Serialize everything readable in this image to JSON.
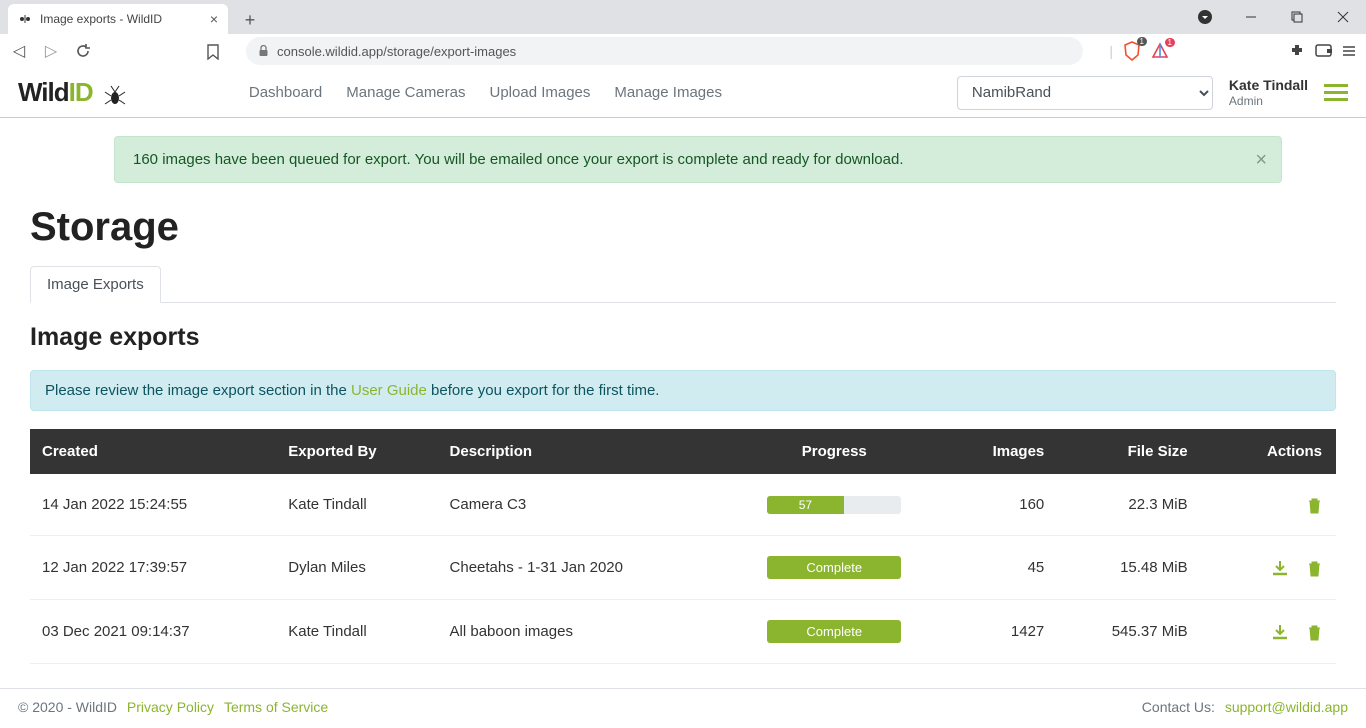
{
  "browser": {
    "tab_title": "Image exports - WildID",
    "url": "console.wildid.app/storage/export-images",
    "shield_badge": "1",
    "triangle_badge": "1"
  },
  "header": {
    "nav": [
      "Dashboard",
      "Manage Cameras",
      "Upload Images",
      "Manage Images"
    ],
    "project_selected": "NamibRand",
    "user_name": "Kate Tindall",
    "user_role": "Admin"
  },
  "alert_success": "160 images have been queued for export. You will be emailed once your export is complete and ready for download.",
  "page_title": "Storage",
  "active_tab": "Image Exports",
  "section_title": "Image exports",
  "info_prefix": "Please review the image export section in the ",
  "info_link": "User Guide",
  "info_suffix": " before you export for the first time.",
  "table": {
    "headers": {
      "created": "Created",
      "exported_by": "Exported By",
      "description": "Description",
      "progress": "Progress",
      "images": "Images",
      "file_size": "File Size",
      "actions": "Actions"
    },
    "rows": [
      {
        "created": "14 Jan 2022 15:24:55",
        "exported_by": "Kate Tindall",
        "description": "Camera C3",
        "progress_pct": 57,
        "progress_label": "57",
        "complete": false,
        "images": "160",
        "file_size": "22.3 MiB",
        "downloadable": false
      },
      {
        "created": "12 Jan 2022 17:39:57",
        "exported_by": "Dylan Miles",
        "description": "Cheetahs - 1-31 Jan 2020",
        "complete": true,
        "complete_label": "Complete",
        "images": "45",
        "file_size": "15.48 MiB",
        "downloadable": true
      },
      {
        "created": "03 Dec 2021 09:14:37",
        "exported_by": "Kate Tindall",
        "description": "All baboon images",
        "complete": true,
        "complete_label": "Complete",
        "images": "1427",
        "file_size": "545.37 MiB",
        "downloadable": true
      }
    ]
  },
  "footer": {
    "copyright": "© 2020 - WildID",
    "privacy": "Privacy Policy",
    "terms": "Terms of Service",
    "contact_label": "Contact Us: ",
    "contact_email": "support@wildid.app"
  }
}
